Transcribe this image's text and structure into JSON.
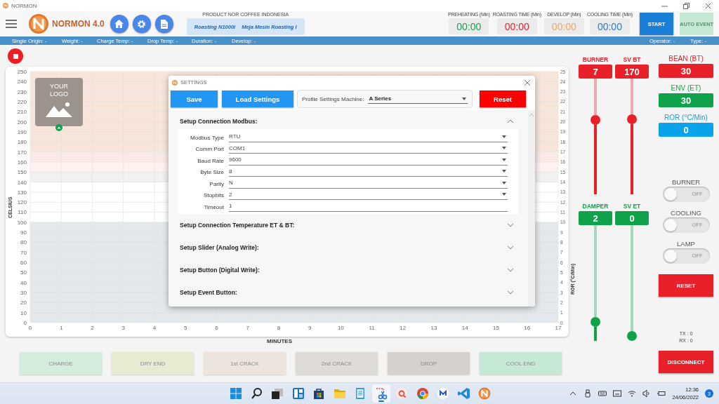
{
  "window": {
    "title": "NORMON"
  },
  "header": {
    "app_name": "NORMON 4.0",
    "product_label": "PRODUCT NOR COFFEE INDONESIA",
    "product_items": [
      "Roasting N1000i",
      "Meja Mesin Roasting I"
    ],
    "timers": [
      {
        "label": "PREHEATING (Min)",
        "value": "00:00",
        "color": "#19a04b"
      },
      {
        "label": "ROASTING TIME (Min)",
        "value": "00:00",
        "color": "#ea1c2b"
      },
      {
        "label": "DEVELOP (Min)",
        "value": "00:00",
        "color": "#f4a460"
      },
      {
        "label": "COOLING TIME (Min)",
        "value": "00:00",
        "color": "#2a7bd6"
      }
    ],
    "buttons": [
      {
        "label": "START",
        "disabled": false
      },
      {
        "label": "AUTO EVENT",
        "disabled": true
      }
    ]
  },
  "info_bar": {
    "left": [
      "Single Origin: -",
      "Weight: -",
      "Charge Temp: -",
      "Drop Temp: -",
      "Duration: -",
      "Develop: -"
    ],
    "right": [
      "Operator: -",
      "Type: -"
    ]
  },
  "chart": {
    "logo_text": "YOUR LOGO",
    "ylabel": "CELSIUS",
    "y_ticks": [
      "250",
      "240",
      "230",
      "220",
      "210",
      "200",
      "190",
      "180",
      "170",
      "160",
      "150",
      "140",
      "130",
      "120",
      "110",
      "100",
      "90",
      "80",
      "70",
      "60",
      "50",
      "40",
      "30",
      "20",
      "10",
      "0"
    ],
    "y2label": "ROR (°C/Min)",
    "y2_ticks": [
      "25",
      "24",
      "23",
      "22",
      "21",
      "20",
      "19",
      "18",
      "17",
      "16",
      "15",
      "14",
      "13",
      "12",
      "11",
      "10",
      "9",
      "8",
      "7",
      "6",
      "5",
      "4",
      "3",
      "2",
      "1",
      "0"
    ],
    "xlabel": "MINUTES",
    "x_ticks": [
      "0",
      "1",
      "2",
      "3",
      "4",
      "5",
      "6",
      "7",
      "8",
      "9",
      "10",
      "11",
      "12",
      "13",
      "14",
      "15",
      "16",
      "17"
    ]
  },
  "events": [
    {
      "label": "CHARGE",
      "color": "#d3ecdc",
      "disabled": true
    },
    {
      "label": "DRY END",
      "color": "#e9ead2",
      "disabled": true
    },
    {
      "label": "1st CRACK",
      "color": "#ede5dd",
      "disabled": true
    },
    {
      "label": "2nd CRACK",
      "color": "#dfdbd6",
      "disabled": true
    },
    {
      "label": "DROP",
      "color": "#d6d1cd",
      "disabled": true
    },
    {
      "label": "COOL END",
      "color": "#c6e9d5",
      "disabled": true
    }
  ],
  "sliders": [
    {
      "label": "BURNER",
      "value": "7",
      "color": "#e8202a",
      "level": 0.65
    },
    {
      "label": "SV BT",
      "value": "170",
      "color": "#e8202a",
      "level": 0.66
    },
    {
      "label": "DAMPER",
      "value": "2",
      "color": "#10a24a",
      "level": 0.13
    },
    {
      "label": "SV ET",
      "value": "0",
      "color": "#10a24a",
      "level": 0
    }
  ],
  "readouts": [
    {
      "label": "BEAN (BT)",
      "value": "30",
      "color": "#e8202a"
    },
    {
      "label": "ENV (ET)",
      "value": "30",
      "color": "#10a24a"
    },
    {
      "label": "ROR (°C/Min)",
      "value": "0",
      "color": "#0aa3ea"
    }
  ],
  "toggles": [
    {
      "label": "BURNER",
      "on": false,
      "state_text": "OFF"
    },
    {
      "label": "COOLING",
      "on": false,
      "state_text": "OFF"
    },
    {
      "label": "LAMP",
      "on": false,
      "state_text": "OFF"
    }
  ],
  "reset_button": "RESET",
  "tx": "TX : 0",
  "rx": "RX : 0",
  "disconnect_button": "DISCONNECT",
  "settings": {
    "title": "SETTINGS",
    "buttons": [
      "Save",
      "Load Settings"
    ],
    "profile": {
      "label": "Profile Settings Machine:",
      "value": "A Series"
    },
    "reset": "Reset",
    "sections": [
      {
        "title": "Setup Connection Modbus:",
        "expanded": true,
        "fields": [
          {
            "label": "Modbus Type",
            "value": "RTU",
            "kind": "select"
          },
          {
            "label": "Comm Port",
            "value": "COM1",
            "kind": "select"
          },
          {
            "label": "Baud Rate",
            "value": "9600",
            "kind": "select"
          },
          {
            "label": "Byte Size",
            "value": "8",
            "kind": "select"
          },
          {
            "label": "Parity",
            "value": "N",
            "kind": "select"
          },
          {
            "label": "Stopbits",
            "value": "2",
            "kind": "select"
          },
          {
            "label": "Timeout",
            "value": "1",
            "kind": "text"
          }
        ]
      },
      {
        "title": "Setup Connection Temperature ET & BT:",
        "expanded": false
      },
      {
        "title": "Setup Slider (Analog Write):",
        "expanded": false
      },
      {
        "title": "Setup Button (Digital Write):",
        "expanded": false
      },
      {
        "title": "Setup Event Button:",
        "expanded": false
      }
    ]
  },
  "taskbar": {
    "apps": [
      {
        "kind": "start",
        "active": false
      },
      {
        "kind": "search",
        "active": false
      },
      {
        "kind": "taskview",
        "active": false
      },
      {
        "kind": "widgets",
        "active": false
      },
      {
        "kind": "store",
        "active": false
      },
      {
        "kind": "folder",
        "active": false
      },
      {
        "kind": "notepad",
        "active": false
      },
      {
        "kind": "snip",
        "active": true
      },
      {
        "kind": "reader",
        "active": false
      },
      {
        "kind": "browser",
        "active": false
      },
      {
        "kind": "chat",
        "active": false
      },
      {
        "kind": "code",
        "active": false
      },
      {
        "kind": "normon",
        "active": false
      }
    ],
    "time": "12:36",
    "date": "24/06/2022",
    "notifications": "3"
  }
}
